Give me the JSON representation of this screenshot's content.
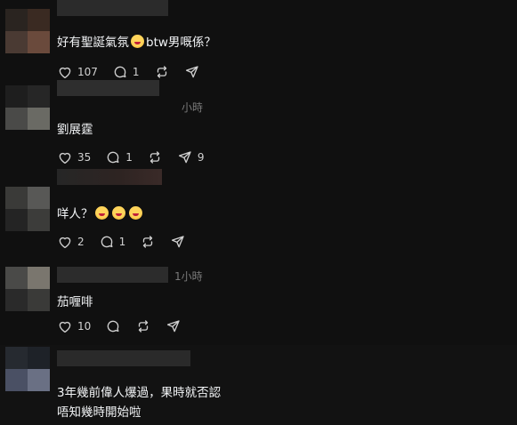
{
  "comments": [
    {
      "text_before": "好有聖誕氣氛",
      "text_after": "btw男嘅係？",
      "time": "",
      "likes": "107",
      "replies": "1",
      "reposts": "",
      "shares": ""
    },
    {
      "text": "劉展霆",
      "time": "小時",
      "likes": "35",
      "replies": "1",
      "reposts": "",
      "shares": "9"
    },
    {
      "text_before": "咩人？",
      "time": "",
      "likes": "2",
      "replies": "1",
      "reposts": "",
      "shares": ""
    },
    {
      "text": "茄喱啡",
      "time": "1小時",
      "likes": "10",
      "replies": "",
      "reposts": "",
      "shares": ""
    },
    {
      "line1": "3年幾前偉人爆過，果時就否認",
      "line2": "唔知幾時開始啦",
      "time": ""
    }
  ],
  "icons": [
    "heart-icon",
    "reply-icon",
    "repost-icon",
    "share-icon",
    "emoji-icon"
  ],
  "colors": {
    "background": "#101010",
    "text": "#f3f5f7",
    "muted": "#7a7a7a"
  }
}
